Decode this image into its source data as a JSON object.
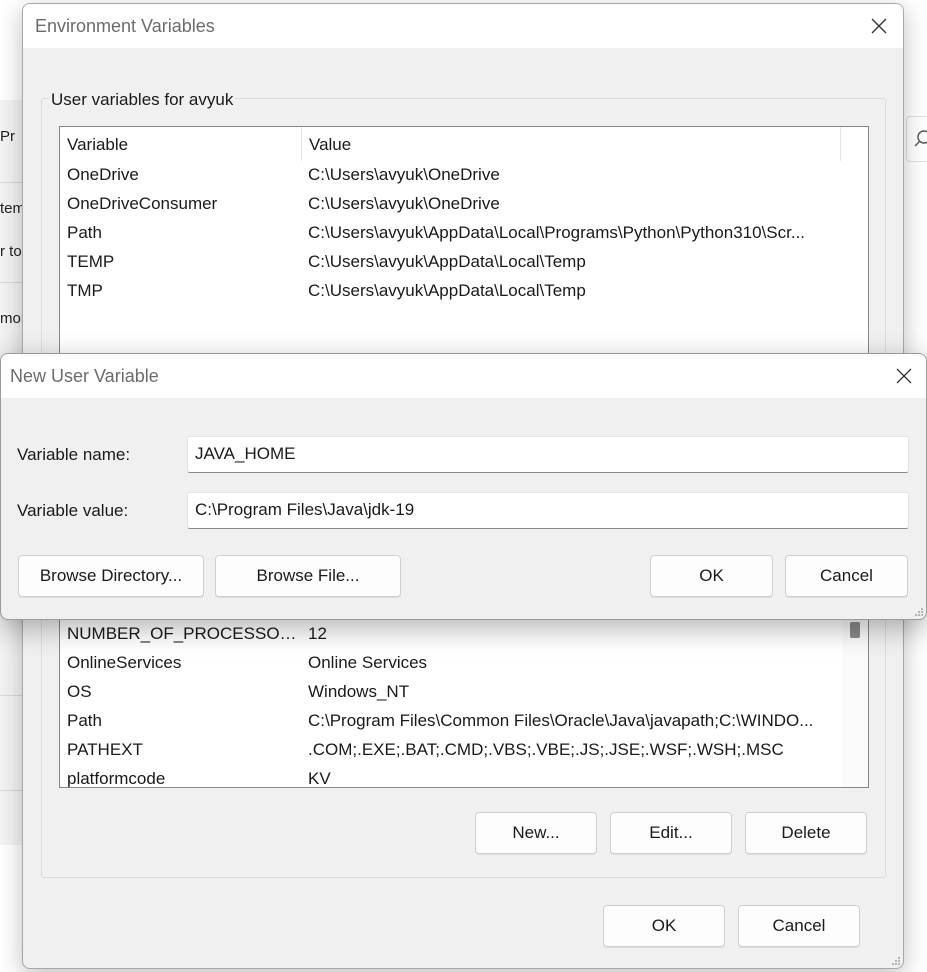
{
  "background_window": {
    "fragments": [
      "Pr",
      "tem",
      "r to",
      "mon"
    ]
  },
  "env_dialog": {
    "title": "Environment Variables",
    "user_group_label": "User variables for avyuk",
    "columns": [
      "Variable",
      "Value"
    ],
    "user_vars": [
      {
        "name": "OneDrive",
        "value": "C:\\Users\\avyuk\\OneDrive"
      },
      {
        "name": "OneDriveConsumer",
        "value": "C:\\Users\\avyuk\\OneDrive"
      },
      {
        "name": "Path",
        "value": "C:\\Users\\avyuk\\AppData\\Local\\Programs\\Python\\Python310\\Scr..."
      },
      {
        "name": "TEMP",
        "value": "C:\\Users\\avyuk\\AppData\\Local\\Temp"
      },
      {
        "name": "TMP",
        "value": "C:\\Users\\avyuk\\AppData\\Local\\Temp"
      }
    ],
    "system_vars": [
      {
        "name": "NUMBER_OF_PROCESSORS",
        "value": "12"
      },
      {
        "name": "OnlineServices",
        "value": "Online Services"
      },
      {
        "name": "OS",
        "value": "Windows_NT"
      },
      {
        "name": "Path",
        "value": "C:\\Program Files\\Common Files\\Oracle\\Java\\javapath;C:\\WINDO..."
      },
      {
        "name": "PATHEXT",
        "value": ".COM;.EXE;.BAT;.CMD;.VBS;.VBE;.JS;.JSE;.WSF;.WSH;.MSC"
      },
      {
        "name": "platformcode",
        "value": "KV"
      }
    ],
    "system_buttons": {
      "new": "New...",
      "edit": "Edit...",
      "delete": "Delete"
    },
    "ok_label": "OK",
    "cancel_label": "Cancel"
  },
  "new_dialog": {
    "title": "New User Variable",
    "name_label": "Variable name:",
    "name_value": "JAVA_HOME",
    "value_label": "Variable value:",
    "value_value": "C:\\Program Files\\Java\\jdk-19",
    "browse_directory_label": "Browse Directory...",
    "browse_file_label": "Browse File...",
    "ok_label": "OK",
    "cancel_label": "Cancel"
  }
}
